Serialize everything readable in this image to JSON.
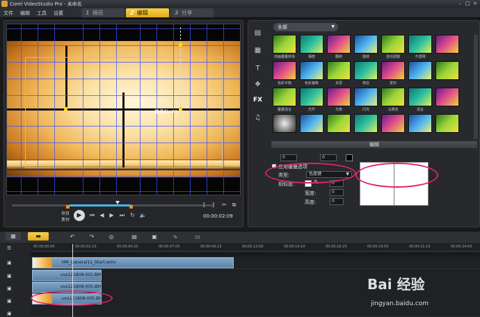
{
  "title": "Corel VideoStudio Pro - 未命名",
  "menu": [
    "文件",
    "编辑",
    "工具",
    "设置"
  ],
  "steps": [
    {
      "num": "1",
      "label": "捕获"
    },
    {
      "num": "2",
      "label": "编辑"
    },
    {
      "num": "3",
      "label": "分享"
    }
  ],
  "preview": {
    "overlay_text": "覆叠轨 #1",
    "mode_project": "项目",
    "mode_clip": "素材",
    "timecode": "00:00:02:09"
  },
  "library": {
    "filter": "全部",
    "edit_tab": "编辑",
    "items": [
      "动画覆叠转场",
      "相册",
      "翻转",
      "旋转",
      "自动调整",
      "不透明",
      "",
      "色彩平衡",
      "色彩偏移",
      "多层",
      "修剪",
      "变形",
      "",
      "",
      "覆叠混合",
      "光芒",
      "光晕",
      "闪光",
      "马赛克",
      "混合",
      "",
      "",
      "",
      "",
      "",
      "",
      "",
      ""
    ]
  },
  "options": {
    "apply_overlay": "应用覆叠选项",
    "type_label": "类型:",
    "type_value": "色度键",
    "similarity_label": "相似度:",
    "similarity_value": "0",
    "width_label": "宽度:",
    "width_value": "0",
    "height_label": "高度:",
    "height_value": "0",
    "top_spin_a": "0",
    "top_spin_b": "0"
  },
  "timeline": {
    "ruler": [
      "00:00:00:00",
      "00:00:02:10",
      "00:00:04:20",
      "00:00:07:05",
      "00:00:09:15",
      "00:00:12:00",
      "00:00:14:10",
      "00:00:16:20",
      "00:00:19:05",
      "00:00:21:15",
      "00:00:24:00"
    ],
    "clips": [
      {
        "name": "HM_General11_Start.wmv"
      },
      {
        "name": "uvs121808-001.BMP"
      },
      {
        "name": "uvs121808-005.BMP"
      },
      {
        "name": "uvs121808-005.BMP"
      }
    ]
  },
  "watermark": {
    "main": "Bai 经验",
    "url": "jingyan.baidu.com"
  },
  "colors": {
    "accent": "#f0c030",
    "timeline_clip": "#6c92b8",
    "highlight_ring": "#e0206a"
  }
}
